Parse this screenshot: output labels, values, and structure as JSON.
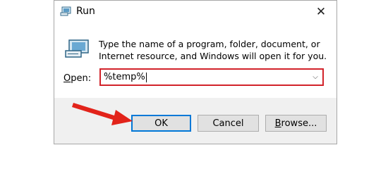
{
  "window": {
    "title": "Run",
    "close_symbol": "✕"
  },
  "content": {
    "description": "Type the name of a program, folder, document, or Internet resource, and Windows will open it for you.",
    "open_label": "Open:",
    "open_value": "%temp%",
    "dropdown_symbol": "⌵"
  },
  "buttons": {
    "ok": "OK",
    "cancel": "Cancel",
    "browse": "Browse..."
  },
  "icons": {
    "title_icon": "run-icon",
    "big_icon": "run-icon",
    "annotation": "red-arrow"
  },
  "colors": {
    "highlight_border": "#d2232a",
    "ok_border": "#0078d7",
    "arrow": "#e2231a"
  }
}
